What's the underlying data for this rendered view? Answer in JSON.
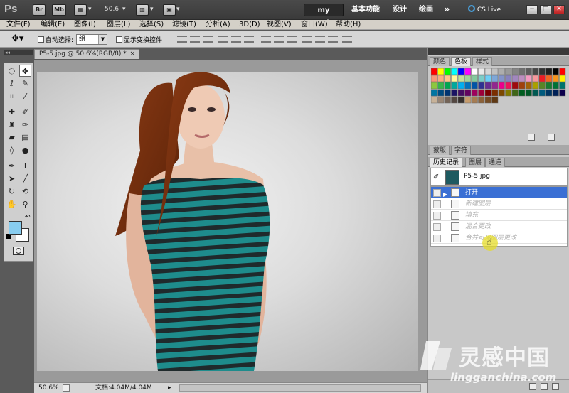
{
  "app": {
    "logo": "Ps",
    "br_label": "Br",
    "mb_label": "Mb",
    "zoom_value": "50.6",
    "workspaces": [
      "my works",
      "基本功能",
      "设计",
      "绘画"
    ],
    "more": "»",
    "cs_live": "CS Live",
    "win_controls": [
      "−",
      "□",
      "✕"
    ]
  },
  "menu": [
    "文件(F)",
    "编辑(E)",
    "图像(I)",
    "图层(L)",
    "选择(S)",
    "滤镜(T)",
    "分析(A)",
    "3D(D)",
    "视图(V)",
    "窗口(W)",
    "帮助(H)"
  ],
  "options": {
    "auto_select_label": "自动选择:",
    "auto_select_value": "组",
    "show_transform_label": "显示变换控件"
  },
  "document": {
    "tab_title": "P5-5.jpg @ 50.6%(RGB/8) *",
    "close": "×",
    "status_zoom": "50.6%",
    "status_doc": "文档:4.04M/4.04M"
  },
  "panels": {
    "top_tabs": [
      "颜色",
      "色板",
      "样式"
    ],
    "mid_tabs": [
      "蒙版",
      "字符"
    ],
    "history_tabs": [
      "历史记录",
      "图层",
      "通道"
    ],
    "snapshot_name": "P5-5.jpg",
    "history_items": [
      {
        "label": "打开",
        "selected": true
      },
      {
        "label": "新建图层",
        "selected": false
      },
      {
        "label": "填充",
        "selected": false
      },
      {
        "label": "混合更改",
        "selected": false
      },
      {
        "label": "合并可见图层更改",
        "selected": false
      }
    ]
  },
  "watermark": {
    "title": "灵感中国",
    "url": "lingganchina.com"
  },
  "colors": {
    "foreground": "#88cdf0",
    "background": "#ffffff",
    "selection": "#3a6fd4",
    "shirt_teal": "#1e8c8c"
  }
}
